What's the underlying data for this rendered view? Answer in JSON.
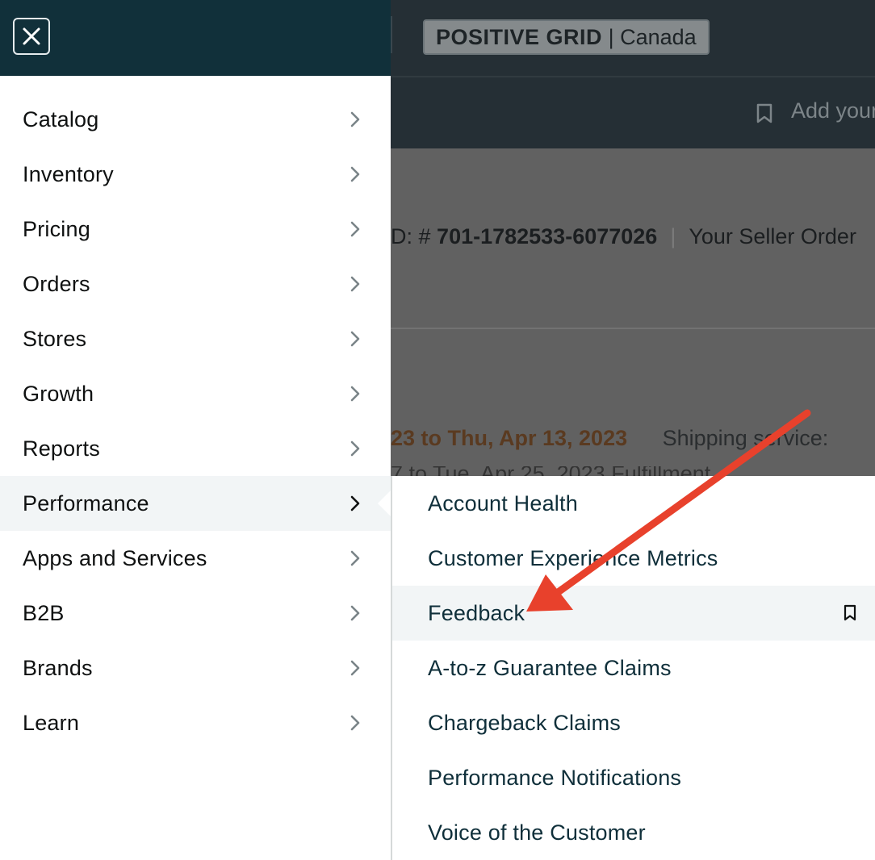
{
  "background_page": {
    "store_brand": "POSITIVE GRID",
    "store_separator": "|",
    "store_region": "Canada",
    "add_text": "Add your",
    "order_prefix": "D: #",
    "order_id": "701-1782533-6077026",
    "order_divider": "|",
    "seller_order_label": "Your Seller Order",
    "date_range": "23 to Thu, Apr 13, 2023",
    "shipping_label": "Shipping service:",
    "partial_line": "7 to Tue, Apr 25, 2023   Fulfillment"
  },
  "drawer": {
    "items": [
      {
        "label": "Catalog"
      },
      {
        "label": "Inventory"
      },
      {
        "label": "Pricing"
      },
      {
        "label": "Orders"
      },
      {
        "label": "Stores"
      },
      {
        "label": "Growth"
      },
      {
        "label": "Reports"
      },
      {
        "label": "Performance",
        "active": true
      },
      {
        "label": "Apps and Services"
      },
      {
        "label": "B2B"
      },
      {
        "label": "Brands"
      },
      {
        "label": "Learn"
      }
    ]
  },
  "submenu": {
    "items": [
      {
        "label": "Account Health"
      },
      {
        "label": "Customer Experience Metrics"
      },
      {
        "label": "Feedback",
        "highlighted": true,
        "bookmark": true
      },
      {
        "label": "A-to-z Guarantee Claims"
      },
      {
        "label": "Chargeback Claims"
      },
      {
        "label": "Performance Notifications"
      },
      {
        "label": "Voice of the Customer"
      }
    ]
  },
  "icons": {
    "close": "close-icon",
    "chevron": "chevron-right-icon",
    "bookmark": "bookmark-icon"
  },
  "colors": {
    "drawer_header": "#11303a",
    "active_row": "#f2f5f6",
    "annotation_arrow": "#e8412c"
  }
}
